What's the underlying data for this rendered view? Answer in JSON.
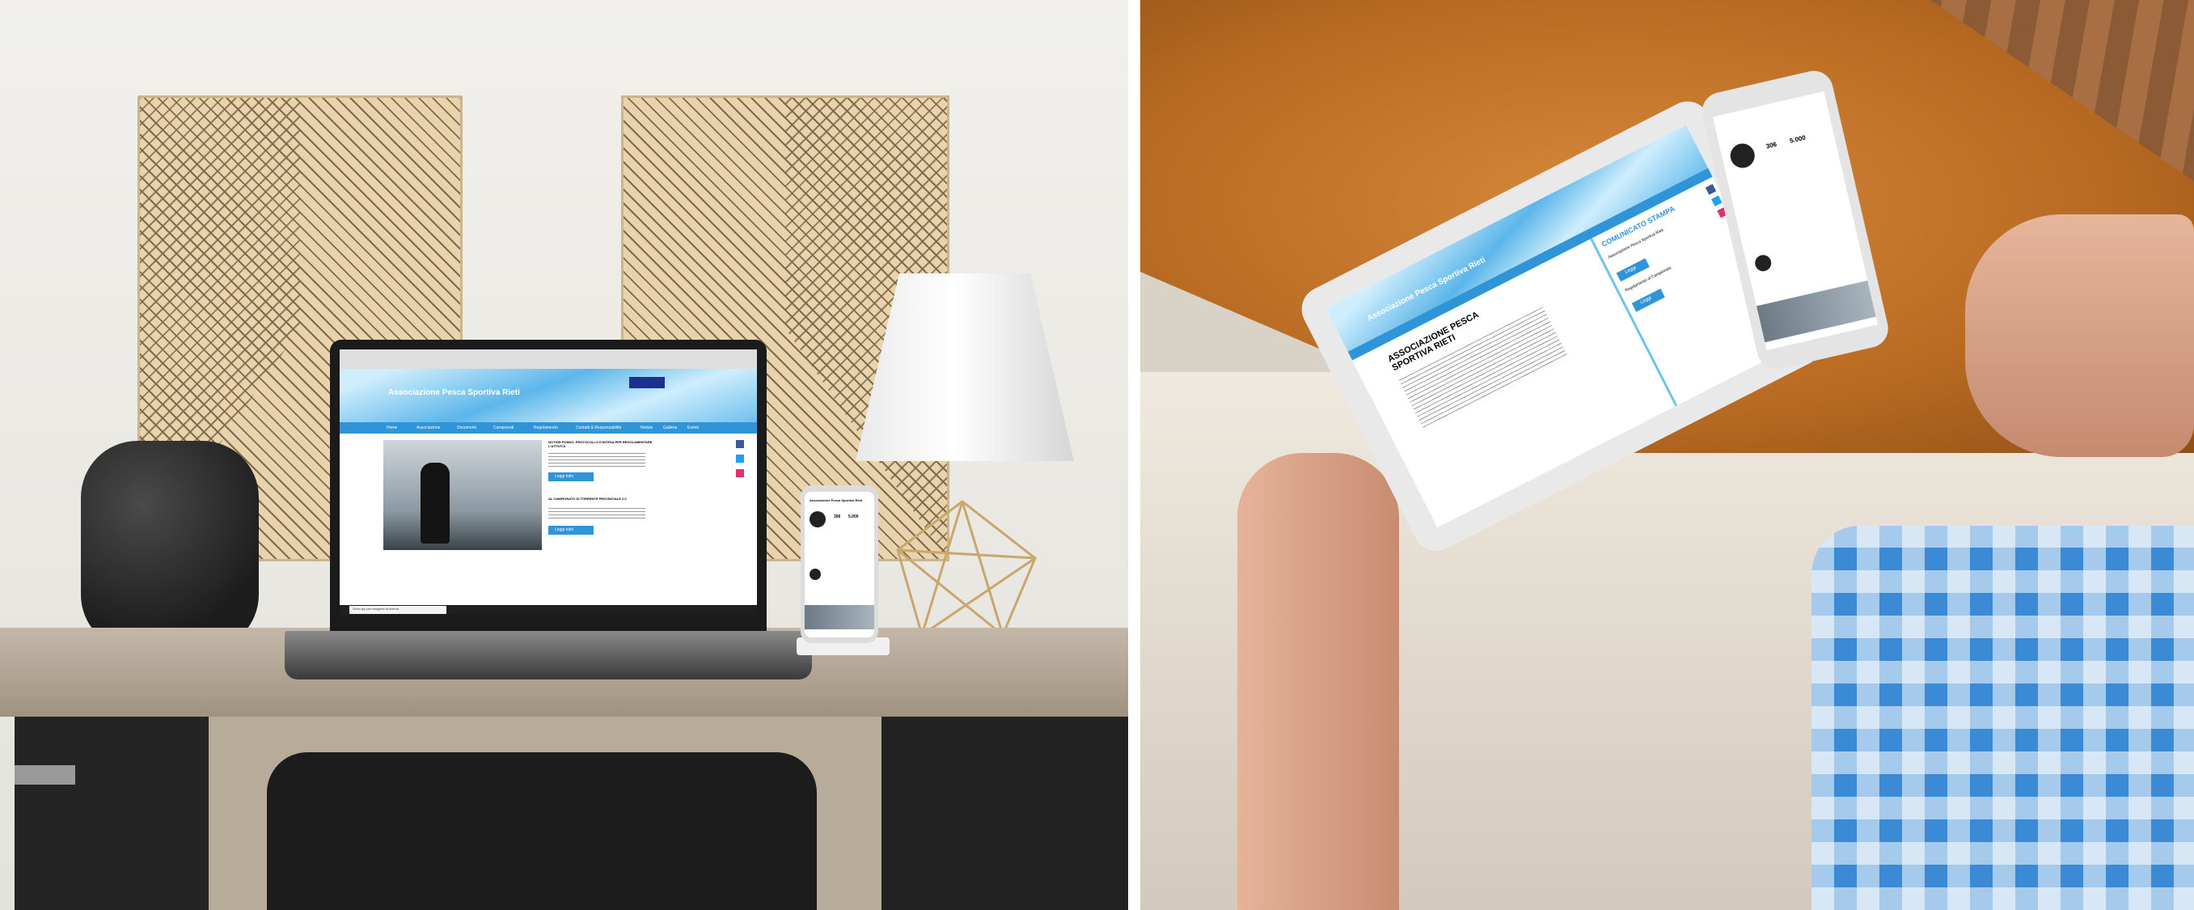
{
  "photo_left": {
    "laptop_site": {
      "title": "Associazione Pesca Sportiva Rieti",
      "nav": [
        "Home",
        "Associazione",
        "Documenti",
        "Campionati",
        "Regolamento",
        "Contatti & Responsabilità",
        "Notizie",
        "Galleria",
        "Eventi"
      ],
      "news_1": "NOTIZIE FONDO: PROTOCOLLO D'INTESA PER REGOLAMENTARE L'ATTIVITÀ",
      "news_2": "AL CAMPIONATO DI TORRENTE PROVINCIALE 2.0",
      "button": "Leggi tutto",
      "taskbar_search": "Scrivi qui per eseguire la ricerca"
    },
    "phone_profile": {
      "name": "Associazione Pesca Sportiva Rieti",
      "posts": "306",
      "followers": "5.000"
    }
  },
  "photo_right": {
    "tablet_site": {
      "title": "Associazione Pesca Sportiva Rieti",
      "main_heading": "ASSOCIAZIONE PESCA SPORTIVA RIETI",
      "sidebar_heading": "COMUNICATO STAMPA",
      "sidebar_item_1": "Associazione Pesca Sportiva Rieti",
      "sidebar_item_2": "Regolamento di Campionato",
      "button": "Leggi"
    },
    "phone_profile": {
      "posts": "306",
      "followers": "5.000"
    }
  },
  "colors": {
    "site_blue": "#2f95d8",
    "site_blue_light": "#8fd0f2",
    "facebook": "#3b5998",
    "twitter": "#1da1f2",
    "instagram": "#e1306c"
  }
}
